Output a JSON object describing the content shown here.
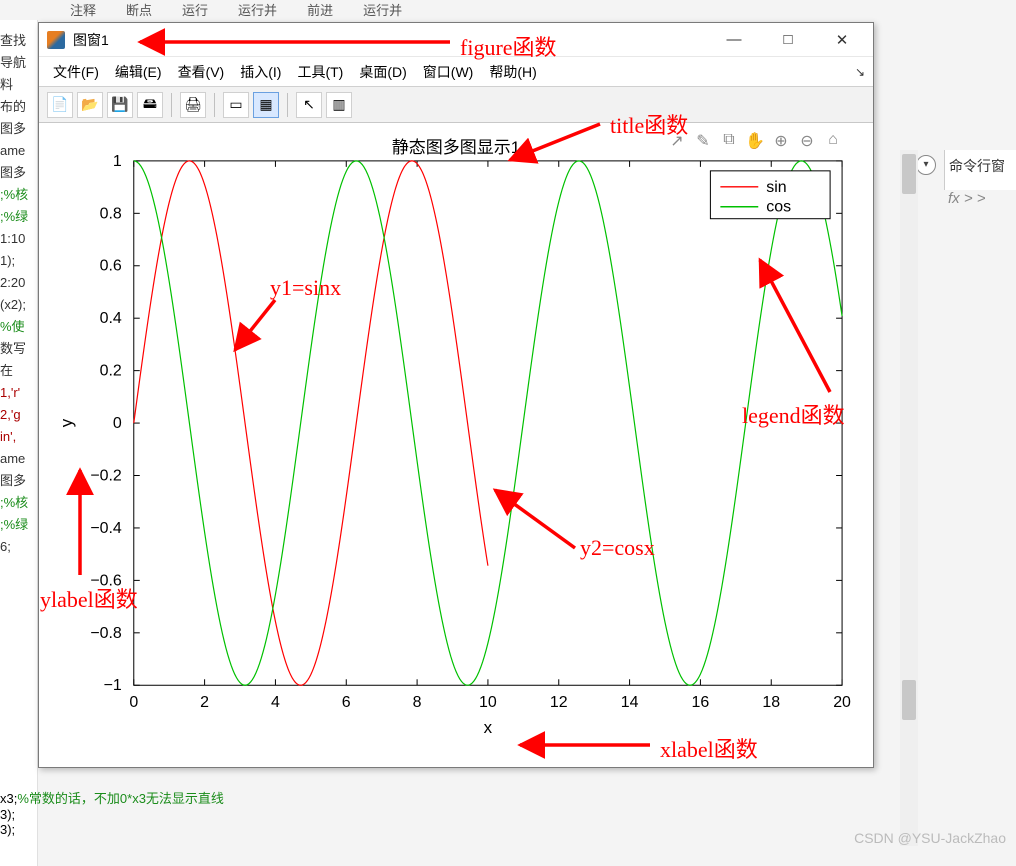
{
  "bg": {
    "top_items": [
      "注释",
      "%",
      "…",
      "…",
      "断点",
      "运行",
      "运行并",
      "前进",
      "运行并"
    ],
    "left_lines": [
      "查找",
      "导航",
      "料",
      "布的",
      "图多",
      "ame",
      "图多",
      ";%核",
      ";%绿",
      "1:10",
      "1);",
      "2:20",
      "(x2);",
      "%使",
      "数写",
      "  在",
      "1,'r'",
      "2,'g",
      "in',",
      "ame",
      "",
      "图多",
      ";%核",
      ";%绿",
      "6;",
      ""
    ],
    "code_line_prefix": "x3;",
    "code_line_comment": "%常数的话，不加0*x3无法显示直线",
    "code_extra": [
      "3);",
      "3);"
    ]
  },
  "right_panel": {
    "title": "命令行窗",
    "fx": "fx  > >"
  },
  "watermark": "CSDN @YSU-JackZhao",
  "window": {
    "title": "图窗1",
    "controls": {
      "min": "—",
      "max": "□",
      "close": "✕"
    },
    "menu": [
      "文件(F)",
      "编辑(E)",
      "查看(V)",
      "插入(I)",
      "工具(T)",
      "桌面(D)",
      "窗口(W)",
      "帮助(H)"
    ],
    "toolbar_icons": [
      "new-file-icon",
      "open-icon",
      "save-icon",
      "save-all-icon",
      "print-icon",
      "data-cursor-icon",
      "brush-icon",
      "link-icon",
      "arrow-icon",
      "colorbar-icon"
    ],
    "axes_tool_icons": [
      "↗",
      "✎",
      "⧉",
      "✋",
      "⊕",
      "⊖",
      "⌂"
    ]
  },
  "annotations": {
    "figure": "figure函数",
    "title": "title函数",
    "ylabel": "ylabel函数",
    "xlabel": "xlabel函数",
    "legend": "legend函数",
    "y1": "y1=sinx",
    "y2": "y2=cosx"
  },
  "chart_data": {
    "type": "line",
    "title": "静态图多图显示1",
    "xlabel": "x",
    "ylabel": "y",
    "xlim": [
      0,
      20
    ],
    "ylim": [
      -1,
      1
    ],
    "xticks": [
      0,
      2,
      4,
      6,
      8,
      10,
      12,
      14,
      16,
      18,
      20
    ],
    "yticks": [
      -1,
      -0.8,
      -0.6,
      -0.4,
      -0.2,
      0,
      0.2,
      0.4,
      0.6,
      0.8,
      1
    ],
    "legend_position": "northeast",
    "series": [
      {
        "name": "sin",
        "color": "#ff0000",
        "x_range": [
          0,
          10
        ],
        "function": "sin(x)"
      },
      {
        "name": "cos",
        "color": "#00c000",
        "x_range": [
          0,
          20
        ],
        "function": "cos(x)"
      }
    ]
  }
}
